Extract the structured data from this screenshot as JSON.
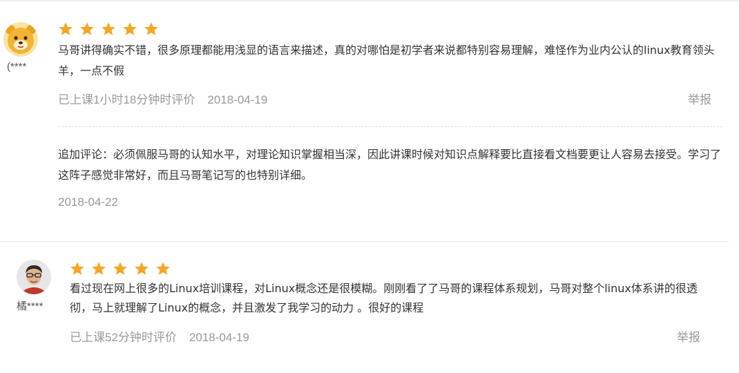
{
  "colors": {
    "star": "#f5a623",
    "text": "#333333",
    "muted": "#999999",
    "separator": "#e5e5e5"
  },
  "reviews": [
    {
      "username": "(****",
      "avatar_icon": "bear-avatar-icon",
      "rating": 5,
      "text": "马哥讲得确实不错，很多原理都能用浅显的语言来描述，真的对哪怕是初学者来说都特别容易理解，难怪作为业内公认的linux教育领头羊，一点不假",
      "study_time": "已上课1小时18分钟时评价",
      "date": "2018-04-19",
      "report_label": "举报",
      "followup": {
        "text": "追加评论：必须佩服马哥的认知水平，对理论知识掌握相当深，因此讲课时候对知识点解释要比直接看文档要更让人容易去接受。学习了这阵子感觉非常好，而且马哥笔记写的也特别详细。",
        "date": "2018-04-22"
      }
    },
    {
      "username": "橘****",
      "avatar_icon": "user-photo-avatar-icon",
      "rating": 5,
      "text": "看过现在网上很多的Linux培训课程，对Linux概念还是很模糊。刚刚看了了马哥的课程体系规划，马哥对整个linux体系讲的很透彻，马上就理解了Linux的概念，并且激发了我学习的动力 。很好的课程",
      "study_time": "已上课52分钟时评价",
      "date": "2018-04-19",
      "report_label": "举报"
    }
  ]
}
